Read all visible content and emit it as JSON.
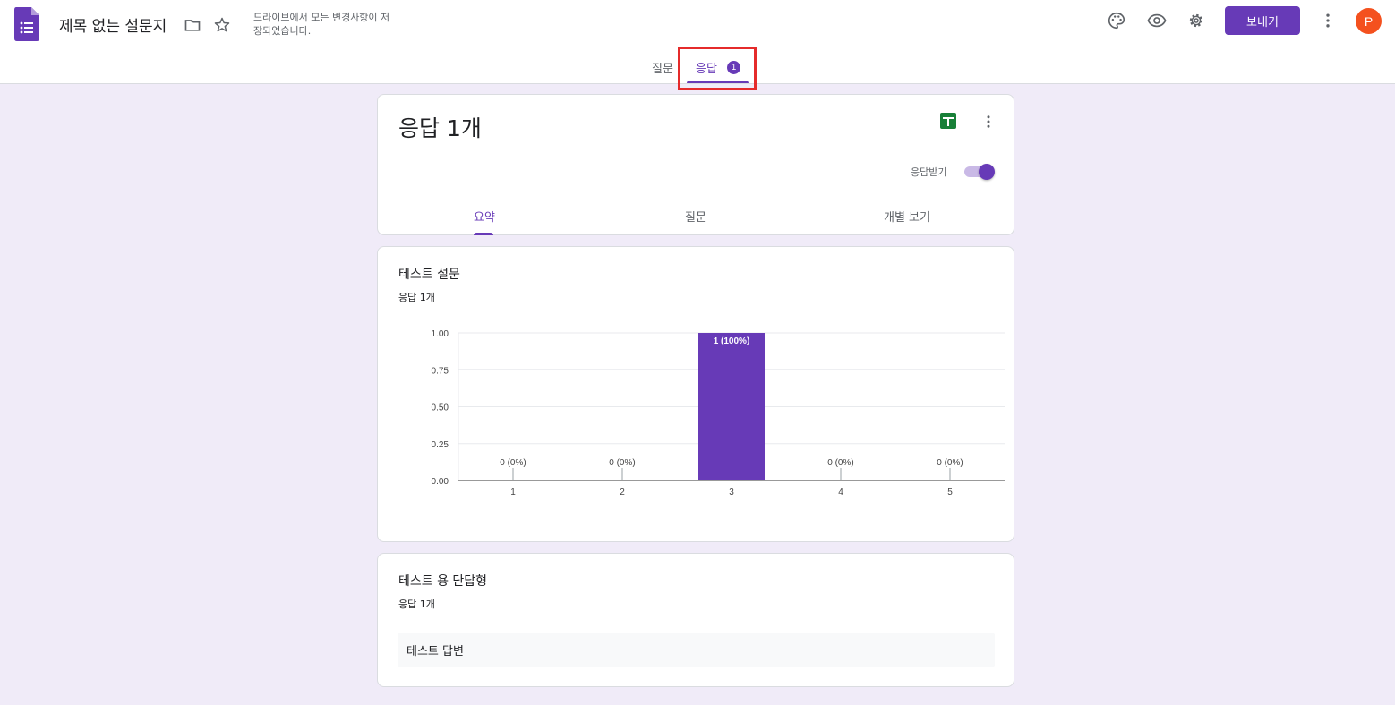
{
  "header": {
    "doc_title": "제목 없는 설문지",
    "save_status": "드라이브에서 모든 변경사항이 저장되었습니다.",
    "send_label": "보내기",
    "avatar_letter": "P",
    "icons": [
      "forms-logo-icon",
      "folder-icon",
      "star-icon",
      "palette-icon",
      "preview-eye-icon",
      "settings-gear-icon",
      "more-vert-icon"
    ],
    "accent_color": "#673ab7"
  },
  "main_tabs": [
    {
      "label": "질문",
      "active": false
    },
    {
      "label": "응답",
      "active": true,
      "badge": "1"
    }
  ],
  "summary_card": {
    "title": "응답 1개",
    "accepting_label": "응답받기",
    "accepting": true,
    "tabs": [
      {
        "label": "요약",
        "active": true
      },
      {
        "label": "질문",
        "active": false
      },
      {
        "label": "개별 보기",
        "active": false
      }
    ]
  },
  "question1": {
    "title": "테스트 설문",
    "response_count": "응답 1개"
  },
  "question2": {
    "title": "테스트 용 단답형",
    "response_count": "응답 1개",
    "answers": [
      "테스트 답변"
    ]
  },
  "chart_data": {
    "type": "bar",
    "categories": [
      "1",
      "2",
      "3",
      "4",
      "5"
    ],
    "values": [
      0,
      0,
      1,
      0,
      0
    ],
    "data_labels": [
      "0 (0%)",
      "0 (0%)",
      "1 (100%)",
      "0 (0%)",
      "0 (0%)"
    ],
    "y_ticks": [
      "0.00",
      "0.25",
      "0.50",
      "0.75",
      "1.00"
    ],
    "ylim": [
      0,
      1
    ],
    "bar_color": "#673ab7",
    "grid": true
  }
}
